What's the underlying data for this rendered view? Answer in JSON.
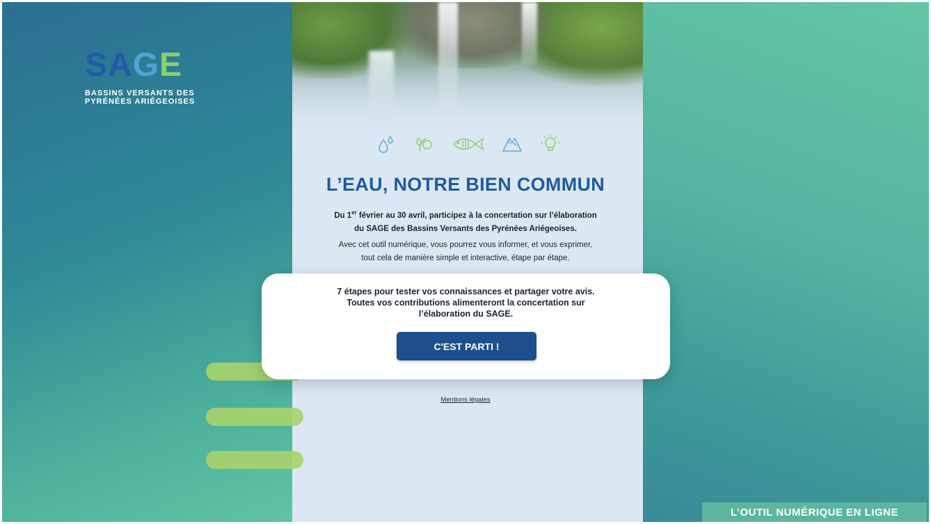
{
  "brand": {
    "logo_word": {
      "s": "S",
      "a": "A",
      "g": "G",
      "e": "E"
    },
    "subtitle_line1": "BASSINS VERSANTS DES",
    "subtitle_line2": "PYRÉNÉES ARIÉGEOISES",
    "colors": {
      "primary": "#1f5ca8",
      "light_blue": "#4fa3d6",
      "green": "#8ccf6a"
    }
  },
  "icons": [
    "water-drops-icon",
    "plant-leaves-icon",
    "fish-icon",
    "mountain-icon",
    "lightbulb-icon"
  ],
  "main": {
    "title": "L’EAU, NOTRE BIEN COMMUN",
    "intro_part1": "Du 1",
    "intro_sup": "er",
    "intro_part2": " février au 30 avril, participez à la concertation sur l’élaboration",
    "intro_line2": "du SAGE des Bassins Versants des Pyrénées Ariégeoises.",
    "desc_line1": "Avec cet outil numérique, vous pourrez vous informer, et vous exprimer,",
    "desc_line2": "tout cela de manière simple et interactive, étape par étape."
  },
  "card": {
    "line1": "7 étapes pour tester vos connaissances et partager votre avis.",
    "line2": "Toutes vos contributions alimenteront la concertation sur",
    "line3": "l’élaboration du SAGE.",
    "button_label": "C'EST PARTI !"
  },
  "footer": {
    "mentions": "Mentions légales",
    "banner": "L’OUTIL NUMÉRIQUE EN LIGNE"
  }
}
